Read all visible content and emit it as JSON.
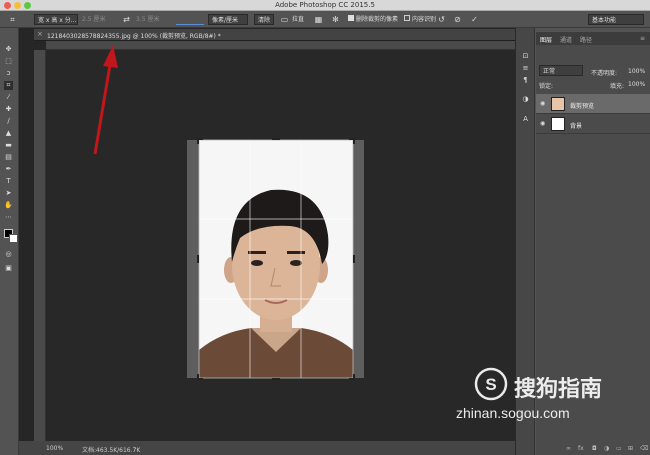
{
  "window": {
    "title": "Adobe Photoshop CC 2015.5",
    "search": "基本功能"
  },
  "options": {
    "preset": "宽 x 高 x 分...",
    "width_placeholder": "2.5 厘米",
    "height_placeholder": "3.5 厘米",
    "resolution_unit": "像素/厘米",
    "clear_label": "清除",
    "straighten_label": "拉直",
    "delete_cropped_label": "删除裁剪的像素",
    "content_aware_label": "内容识别"
  },
  "document": {
    "tab_name": "1218403028578824355.jpg @ 100% (裁剪预览, RGB/8#) *"
  },
  "status": {
    "zoom": "100%",
    "doc_info": "文档:463.5K/616.7K"
  },
  "layers_panel": {
    "tabs": [
      "图层",
      "通道",
      "路径"
    ],
    "blend_mode": "正常",
    "opacity_label": "不透明度:",
    "opacity_value": "100%",
    "lock_label": "锁定:",
    "fill_label": "填充:",
    "fill_value": "100%",
    "layers": [
      {
        "name": "裁剪预览"
      },
      {
        "name": "背景"
      }
    ]
  },
  "watermark": {
    "brand": "搜狗指南",
    "url": "zhinan.sogou.com"
  },
  "colors": {
    "accent": "#c0161c",
    "ui_bg": "#535353",
    "canvas_bg": "#282828"
  }
}
